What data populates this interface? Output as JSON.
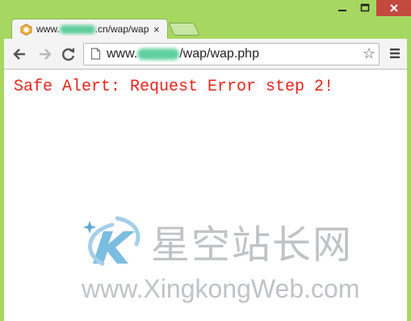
{
  "tab": {
    "title_prefix": "www.",
    "title_suffix": ".cn/wap/wap",
    "close": "×"
  },
  "toolbar": {
    "url_prefix": "www.",
    "url_suffix": "/wap/wap.php",
    "star": "☆"
  },
  "page": {
    "alert_text": "Safe Alert: Request Error step 2!"
  },
  "watermark": {
    "cn_text": "星空站长网",
    "url_text": "www.XingkongWeb.com"
  },
  "colors": {
    "window_frame": "#a6d861",
    "alert_red": "#e8241b",
    "close_button": "#c44a3f",
    "watermark_gray": "#bfc3c6"
  },
  "icons": [
    "minimize-icon",
    "maximize-icon",
    "close-icon",
    "favicon-icon",
    "back-arrow-icon",
    "forward-arrow-icon",
    "reload-icon",
    "page-icon",
    "bookmark-star-icon",
    "menu-icon"
  ]
}
